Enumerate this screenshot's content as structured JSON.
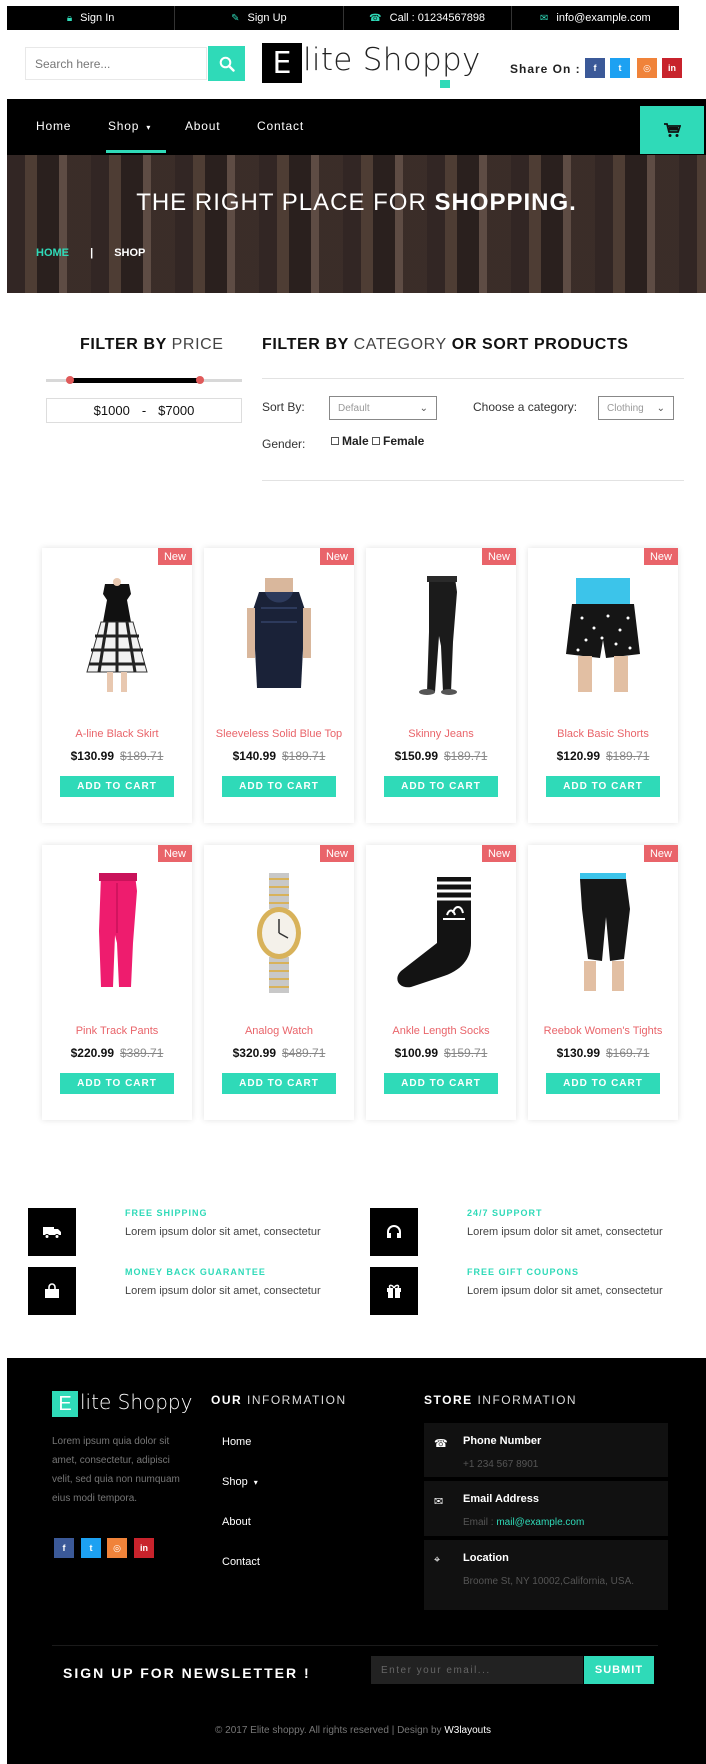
{
  "topbar": {
    "signin": "Sign In",
    "signup": "Sign Up",
    "call": "Call : 01234567898",
    "email": "info@example.com"
  },
  "header": {
    "search_placeholder": "Search here...",
    "logo_letter": "E",
    "logo_rest": "lite Shoppy",
    "share_label": "Share On :"
  },
  "nav": {
    "items": [
      "Home",
      "Shop",
      "About",
      "Contact"
    ],
    "active": "Shop"
  },
  "banner": {
    "title_light": "THE RIGHT PLACE FOR ",
    "title_bold": "SHOPPING.",
    "crumb_home": "HOME",
    "crumb_sep": "|",
    "crumb_current": "SHOP"
  },
  "filter_price": {
    "title_bold": "FILTER BY ",
    "title_light": "PRICE",
    "min": "$1000",
    "sep": "-",
    "max": "$7000"
  },
  "filter_category": {
    "title_bold": "FILTER BY ",
    "title_light": "CATEGORY",
    "title_bold2": " OR SORT PRODUCTS",
    "sort_label": "Sort By:",
    "sort_value": "Default",
    "category_label": "Choose a category:",
    "category_value": "Clothing",
    "gender_label": "Gender:",
    "male": "Male",
    "female": "Female"
  },
  "products": [
    {
      "name": "A-line Black Skirt",
      "price": "$130.99",
      "old": "$189.71",
      "badge": "New",
      "button": "ADD TO CART"
    },
    {
      "name": "Sleeveless Solid Blue Top",
      "price": "$140.99",
      "old": "$189.71",
      "badge": "New",
      "button": "ADD TO CART"
    },
    {
      "name": "Skinny Jeans",
      "price": "$150.99",
      "old": "$189.71",
      "badge": "New",
      "button": "ADD TO CART"
    },
    {
      "name": "Black Basic Shorts",
      "price": "$120.99",
      "old": "$189.71",
      "badge": "New",
      "button": "ADD TO CART"
    },
    {
      "name": "Pink Track Pants",
      "price": "$220.99",
      "old": "$389.71",
      "badge": "New",
      "button": "ADD TO CART"
    },
    {
      "name": "Analog Watch",
      "price": "$320.99",
      "old": "$489.71",
      "badge": "New",
      "button": "ADD TO CART"
    },
    {
      "name": "Ankle Length Socks",
      "price": "$100.99",
      "old": "$159.71",
      "badge": "New",
      "button": "ADD TO CART"
    },
    {
      "name": "Reebok Women's Tights",
      "price": "$130.99",
      "old": "$169.71",
      "badge": "New",
      "button": "ADD TO CART"
    }
  ],
  "features": [
    {
      "title": "FREE SHIPPING",
      "text": "Lorem ipsum dolor sit amet, consectetur"
    },
    {
      "title": "24/7 SUPPORT",
      "text": "Lorem ipsum dolor sit amet, consectetur"
    },
    {
      "title": "MONEY BACK GUARANTEE",
      "text": "Lorem ipsum dolor sit amet, consectetur"
    },
    {
      "title": "FREE GIFT COUPONS",
      "text": "Lorem ipsum dolor sit amet, consectetur"
    }
  ],
  "footer": {
    "logo_letter": "E",
    "logo_rest": "lite Shoppy",
    "desc": "Lorem ipsum quia dolor sit amet, consectetur, adipisci velit, sed quia non numquam eius modi tempora.",
    "info_bold": "OUR",
    "info_light": " INFORMATION",
    "links": [
      "Home",
      "Shop",
      "About",
      "Contact"
    ],
    "store_bold": "STORE",
    "store_light": " INFORMATION",
    "phone_title": "Phone Number",
    "phone_value": "+1 234 567 8901",
    "email_title": "Email Address",
    "email_prefix": "Email : ",
    "email_value": "mail@example.com",
    "location_title": "Location",
    "location_value": "Broome St, NY 10002,California, USA.",
    "newsletter_title": "SIGN UP FOR NEWSLETTER !",
    "newsletter_placeholder": "Enter your email...",
    "newsletter_button": "SUBMIT",
    "copyright": "© 2017 Elite shoppy. All rights reserved | Design by ",
    "designer": "W3layouts"
  },
  "colors": {
    "accent": "#2fdab8",
    "sale": "#e9646a",
    "dark": "#000000",
    "facebook": "#3b5998",
    "twitter": "#1da1f2",
    "instagram": "#f0833a",
    "pinterest": "#c8232c"
  }
}
